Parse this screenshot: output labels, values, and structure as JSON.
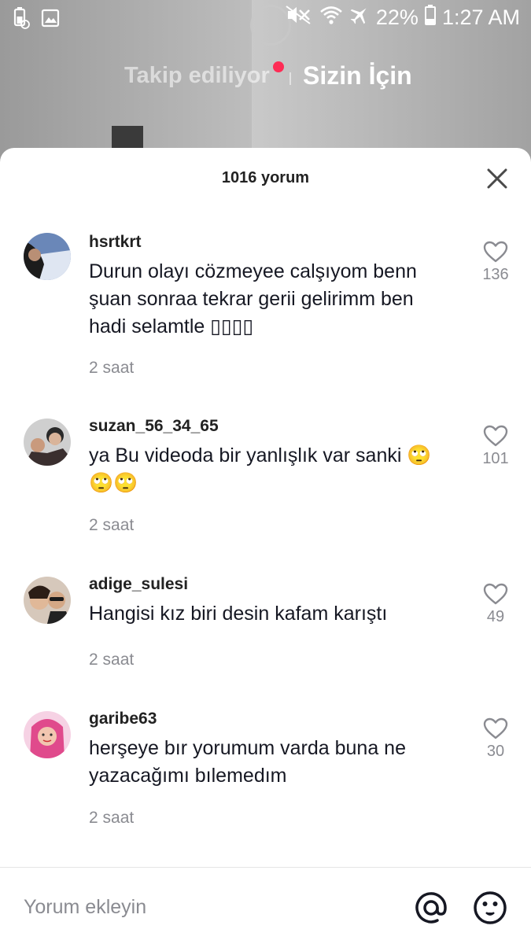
{
  "status_bar": {
    "battery": "22%",
    "time": "1:27 AM",
    "icons": [
      "battery-saver-icon",
      "image-icon",
      "mute-icon",
      "wifi-icon",
      "airplane-mode-icon",
      "battery-icon"
    ]
  },
  "top_tabs": {
    "following": "Takip ediliyor",
    "for_you": "Sizin İçin"
  },
  "comments_sheet": {
    "title": "1016 yorum",
    "comments": [
      {
        "username": "hsrtkrt",
        "text": "Durun olayı cözmeyee calşıyom benn şuan sonraa tekrar gerii gelirimm ben hadi selamtle ▯▯▯▯",
        "time": "2 saat",
        "likes": "136"
      },
      {
        "username": "suzan_56_34_65",
        "text": "ya Bu videoda bir yanlışlık var sanki 🙄🙄🙄",
        "time": "2 saat",
        "likes": "101"
      },
      {
        "username": "adige_sulesi",
        "text": "Hangisi kız biri desin kafam karıştı",
        "time": "2 saat",
        "likes": "49"
      },
      {
        "username": "garibe63",
        "text": "herşeye bır yorumum varda buna ne yazacağımı bılemedım",
        "time": "2 saat",
        "likes": "30"
      }
    ]
  },
  "input_bar": {
    "placeholder": "Yorum ekleyin"
  },
  "colors": {
    "accent": "#fe2c55",
    "muted": "#8a8b91",
    "text": "#161823"
  }
}
